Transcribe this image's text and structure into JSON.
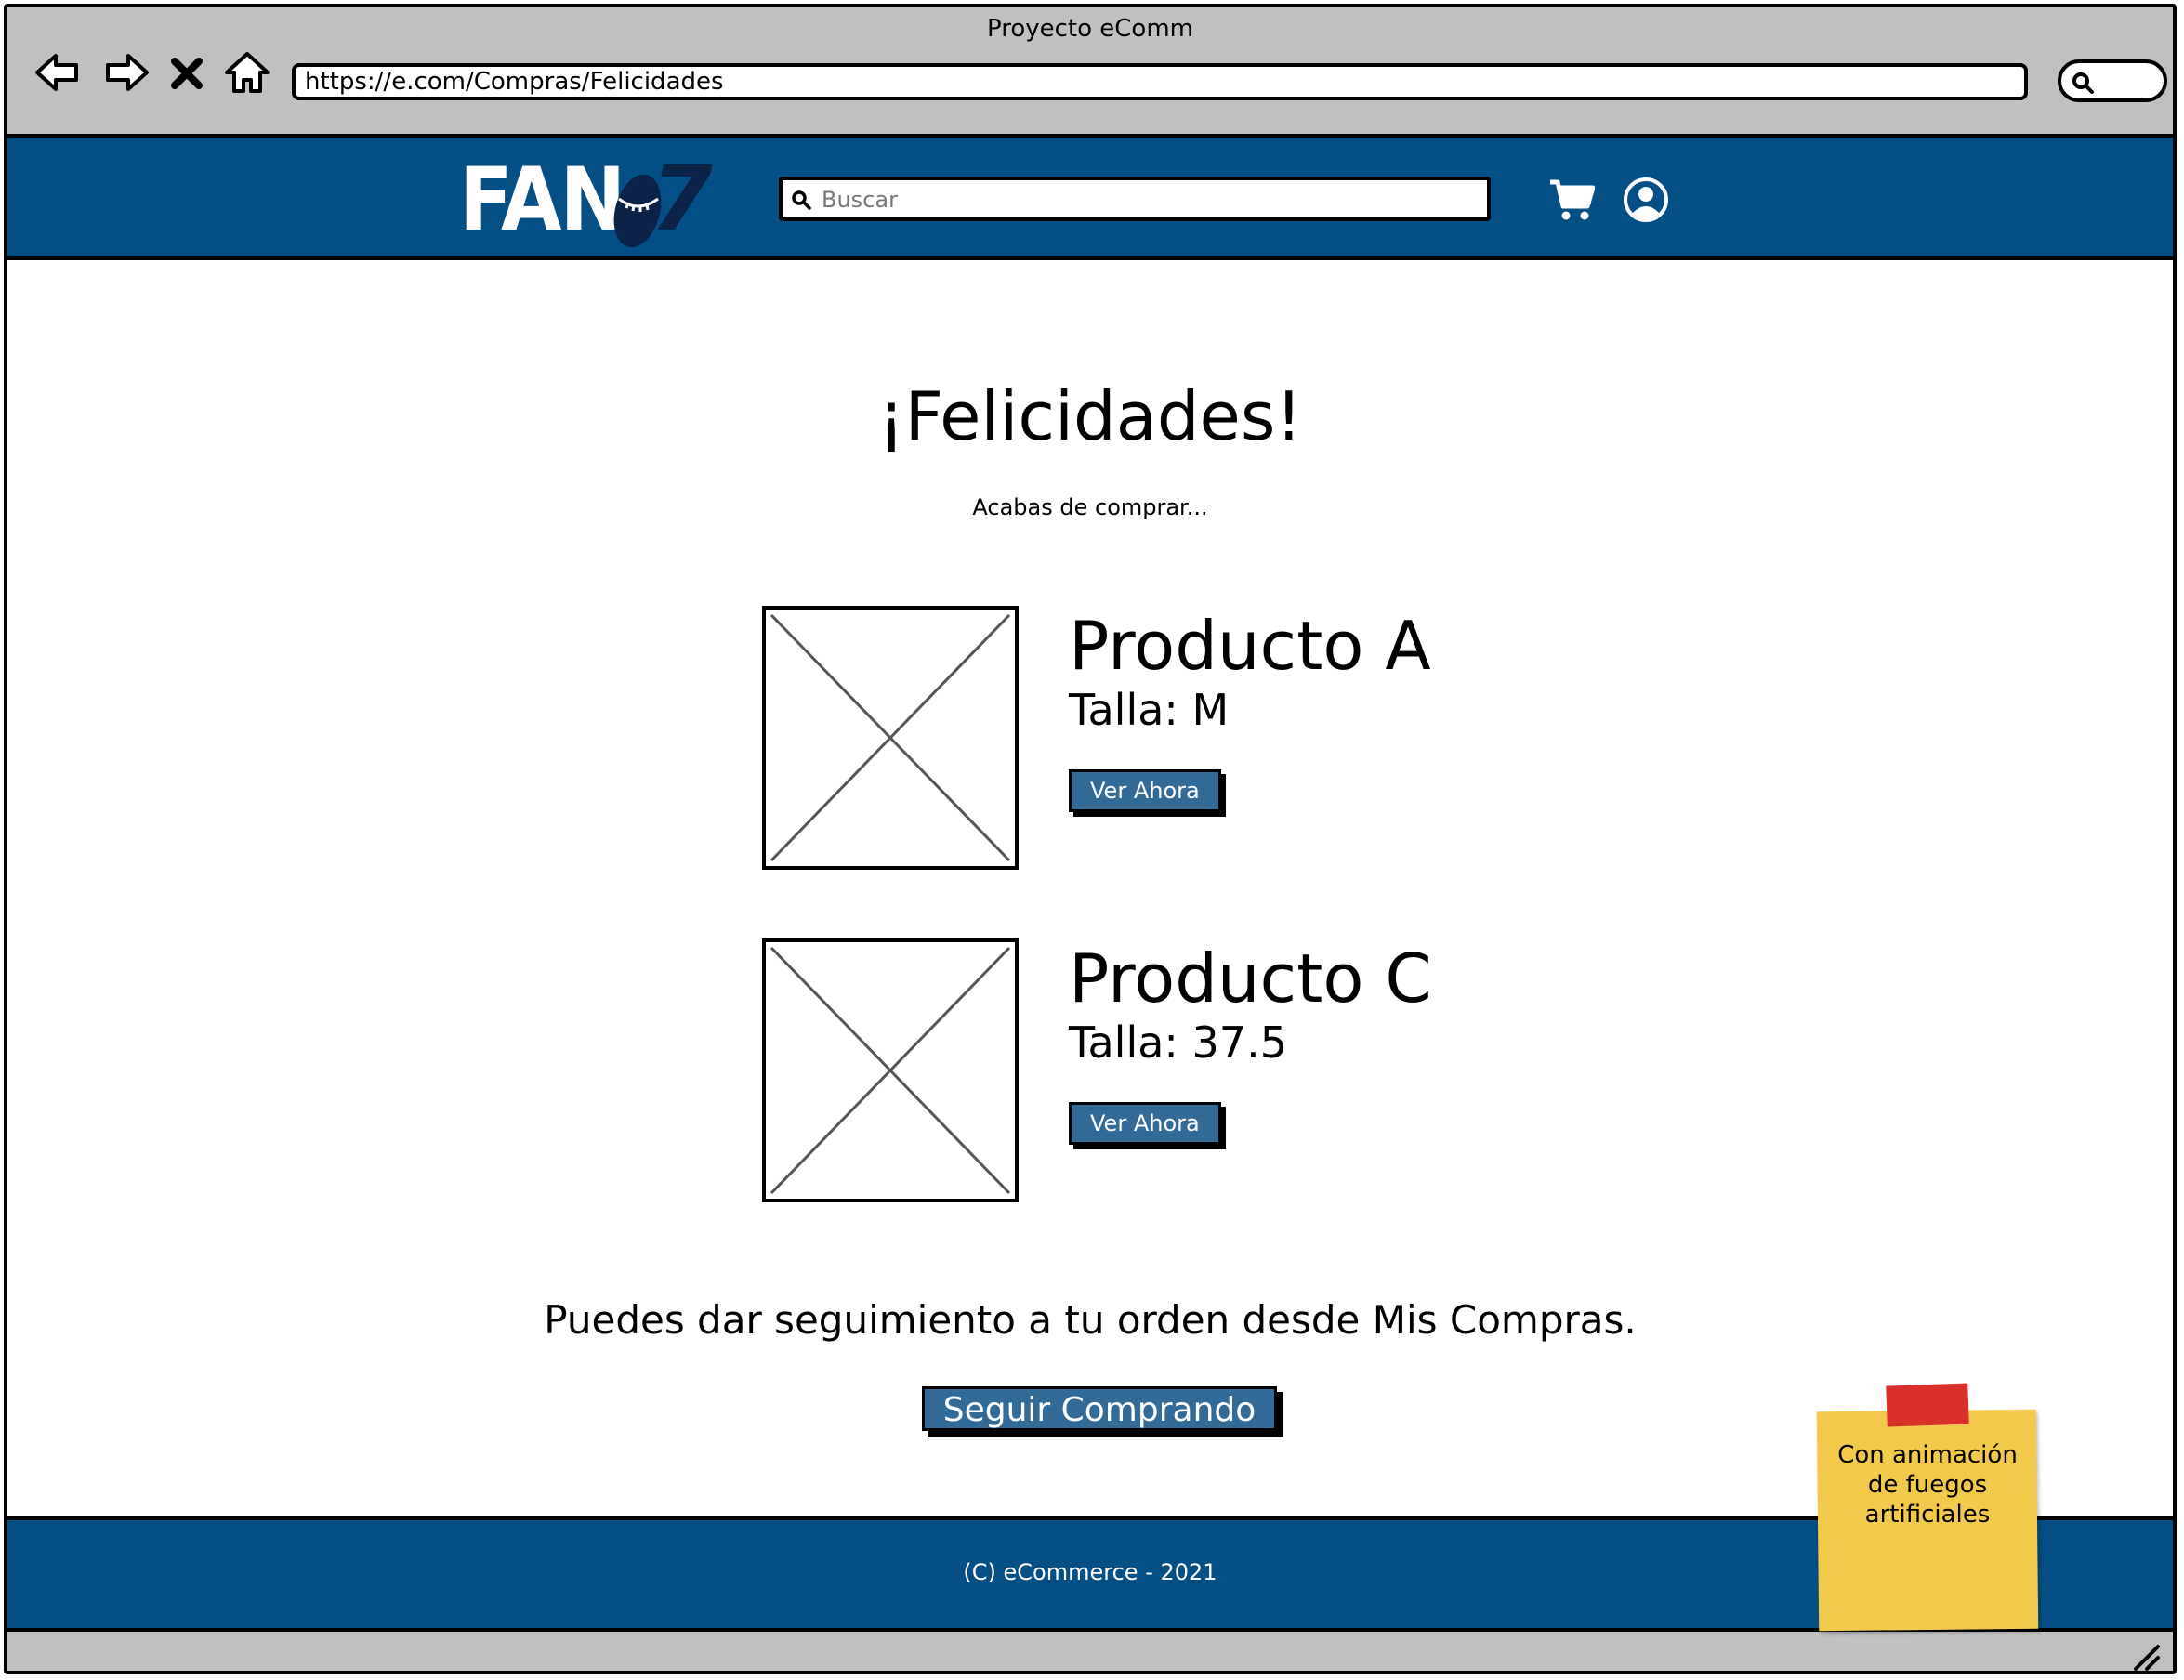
{
  "window": {
    "title": "Proyecto eComm"
  },
  "browser": {
    "url": "https://e.com/Compras/Felicidades",
    "icons": [
      "back-arrow-icon",
      "forward-arrow-icon",
      "close-icon",
      "home-icon",
      "search-icon"
    ]
  },
  "header": {
    "logo_text": "FAN",
    "logo_number": "7",
    "search_placeholder": "Buscar",
    "icons": [
      "search-icon",
      "cart-icon",
      "user-icon"
    ],
    "color": "#034f86"
  },
  "main": {
    "title": "¡Felicidades!",
    "subtitle": "Acabas de comprar...",
    "products": [
      {
        "name": "Producto A",
        "size": "Talla: M",
        "button": "Ver Ahora"
      },
      {
        "name": "Producto C",
        "size": "Talla: 37.5",
        "button": "Ver Ahora"
      }
    ],
    "follow_text": "Puedes dar seguimiento a tu orden desde Mis Compras.",
    "continue_button": "Seguir Comprando",
    "button_color": "#336b98"
  },
  "footer": {
    "text": "(C) eCommerce - 2021"
  },
  "sticky_note": {
    "text": "Con animación\nde fuegos\nartificiales",
    "color": "#f3c94c",
    "tape_color": "#d9302c"
  }
}
